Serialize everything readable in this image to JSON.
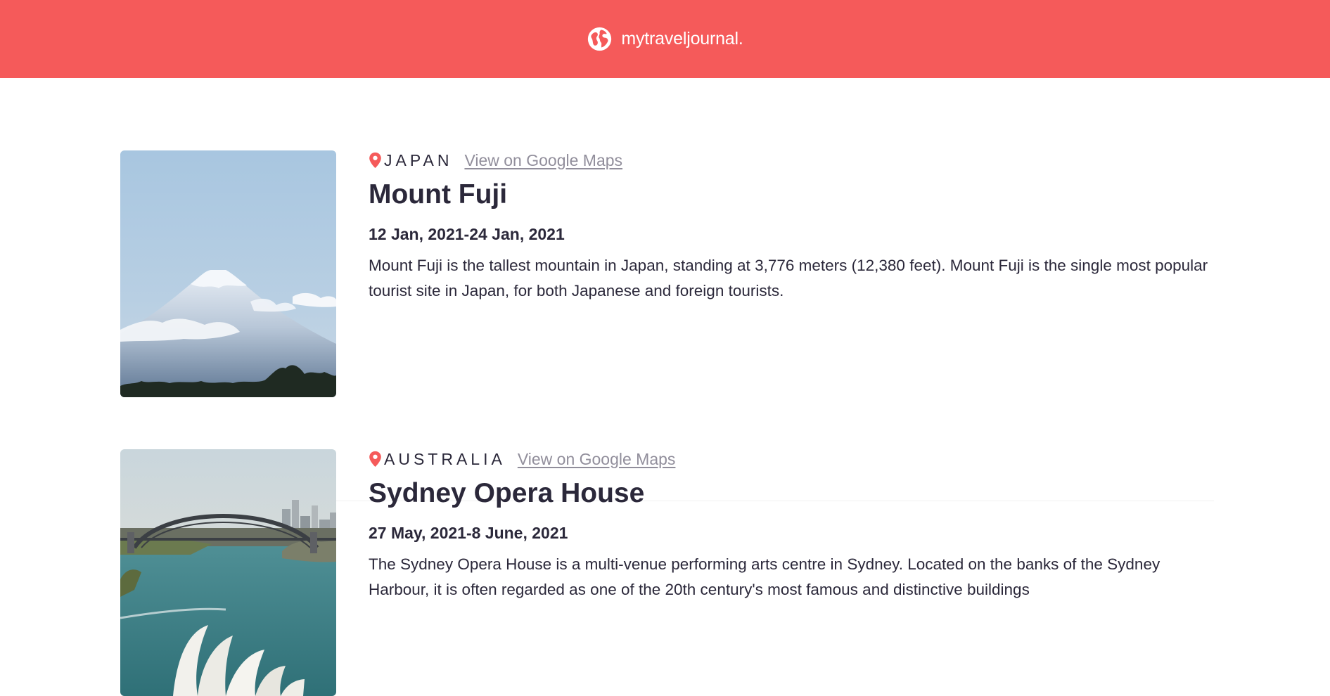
{
  "navbar": {
    "title": "mytraveljournal.",
    "logo_icon": "globe-icon",
    "background": "#f55a5a"
  },
  "entries": [
    {
      "country": "JAPAN",
      "maps_link": "View on Google Maps",
      "title": "Mount Fuji",
      "dates": "12 Jan, 2021-24 Jan, 2021",
      "description": "Mount Fuji is the tallest mountain in Japan, standing at 3,776 meters (12,380 feet). Mount Fuji is the single most popular tourist site in Japan, for both Japanese and foreign tourists."
    },
    {
      "country": "AUSTRALIA",
      "maps_link": "View on Google Maps",
      "title": "Sydney Opera House",
      "dates": "27 May, 2021-8 June, 2021",
      "description": "The Sydney Opera House is a multi-venue performing arts centre in Sydney. Located on the banks of the Sydney Harbour, it is often regarded as one of the 20th century's most famous and distinctive buildings"
    }
  ],
  "colors": {
    "accent": "#f55a5a",
    "text": "#2b283a",
    "link": "#918e9b"
  }
}
